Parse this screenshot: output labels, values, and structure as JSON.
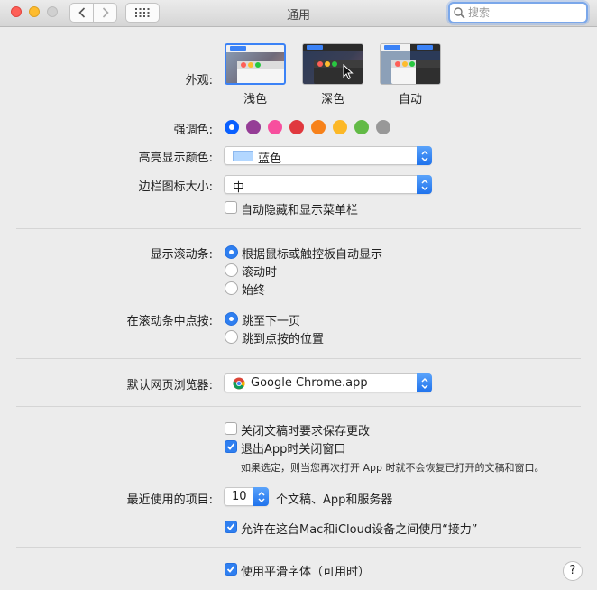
{
  "window": {
    "title": "通用",
    "search_placeholder": "搜索"
  },
  "appearance": {
    "label": "外观:",
    "options": [
      {
        "label": "浅色",
        "selected": true
      },
      {
        "label": "深色",
        "selected": false
      },
      {
        "label": "自动",
        "selected": false
      }
    ]
  },
  "accent": {
    "label": "强调色:",
    "colors": [
      "#0a60ff",
      "#953d96",
      "#f74f9e",
      "#e0383e",
      "#f7821b",
      "#fcb827",
      "#62ba46",
      "#989898"
    ],
    "selected_index": 0
  },
  "highlight": {
    "label": "高亮显示颜色:",
    "value": "蓝色",
    "swatch_color": "#b3d7ff"
  },
  "sidebar_icon": {
    "label": "边栏图标大小:",
    "value": "中"
  },
  "menubar": {
    "auto_hide_label": "自动隐藏和显示菜单栏",
    "checked": false
  },
  "scrollbars": {
    "label": "显示滚动条:",
    "options": [
      {
        "label": "根据鼠标或触控板自动显示",
        "selected": true
      },
      {
        "label": "滚动时",
        "selected": false
      },
      {
        "label": "始终",
        "selected": false
      }
    ]
  },
  "click_scroll": {
    "label": "在滚动条中点按:",
    "options": [
      {
        "label": "跳至下一页",
        "selected": true
      },
      {
        "label": "跳到点按的位置",
        "selected": false
      }
    ]
  },
  "browser": {
    "label": "默认网页浏览器:",
    "value": "Google Chrome.app"
  },
  "documents": {
    "ask_save_label": "关闭文稿时要求保存更改",
    "ask_save_checked": false,
    "close_windows_label": "退出App时关闭窗口",
    "close_windows_checked": true,
    "note": "如果选定，则当您再次打开 App 时就不会恢复已打开的文稿和窗口。"
  },
  "recent": {
    "label": "最近使用的项目:",
    "value": "10",
    "suffix": "个文稿、App和服务器"
  },
  "handoff": {
    "label": "允许在这台Mac和iCloud设备之间使用“接力”",
    "checked": true
  },
  "font_smoothing": {
    "label": "使用平滑字体（可用时）",
    "checked": true
  },
  "help": {
    "label": "?"
  }
}
